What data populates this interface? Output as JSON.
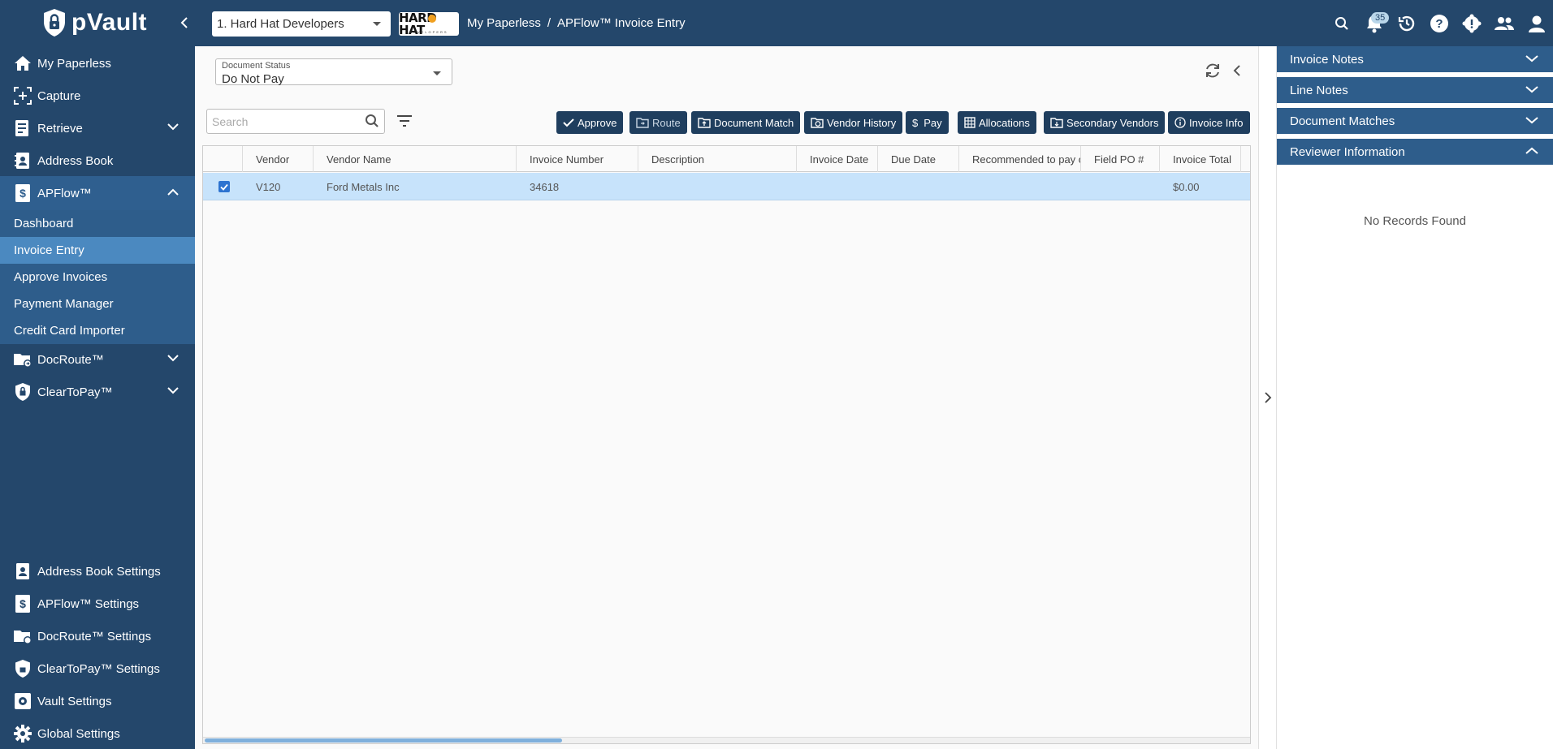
{
  "app": {
    "name": "pVault"
  },
  "header": {
    "company": "1. Hard Hat Developers",
    "company_logo_text": "HARD HAT",
    "company_logo_sub": "DEVELOPERS",
    "breadcrumb": [
      "My Paperless",
      "/",
      "APFlow™ Invoice Entry"
    ],
    "notification_count": "35"
  },
  "sidebar": {
    "items": [
      {
        "label": "My Paperless"
      },
      {
        "label": "Capture"
      },
      {
        "label": "Retrieve"
      },
      {
        "label": "Address Book"
      },
      {
        "label": "APFlow™"
      },
      {
        "label": "DocRoute™"
      },
      {
        "label": "ClearToPay™"
      }
    ],
    "apflow_sub": [
      {
        "label": "Dashboard"
      },
      {
        "label": "Invoice Entry"
      },
      {
        "label": "Approve Invoices"
      },
      {
        "label": "Payment Manager"
      },
      {
        "label": "Credit Card Importer"
      }
    ],
    "settings": [
      {
        "label": "Address Book Settings"
      },
      {
        "label": "APFlow™ Settings"
      },
      {
        "label": "DocRoute™ Settings"
      },
      {
        "label": "ClearToPay™ Settings"
      },
      {
        "label": "Vault Settings"
      },
      {
        "label": "Global Settings"
      }
    ]
  },
  "main": {
    "status_label": "Document Status",
    "status_value": "Do Not Pay",
    "search_placeholder": "Search",
    "actions": [
      {
        "label": "Approve"
      },
      {
        "label": "Route"
      },
      {
        "label": "Document Match"
      },
      {
        "label": "Vendor History"
      },
      {
        "label": "Pay"
      },
      {
        "label": "Allocations"
      },
      {
        "label": "Secondary Vendors"
      },
      {
        "label": "Invoice Info"
      }
    ],
    "columns": [
      "Vendor",
      "Vendor Name",
      "Invoice Number",
      "Description",
      "Invoice Date",
      "Due Date",
      "Recommended to pay on",
      "Field PO #",
      "Invoice Total"
    ],
    "rows": [
      {
        "vendor": "V120",
        "vendor_name": "Ford Metals Inc",
        "invoice_number": "34618",
        "description": "",
        "invoice_date": "",
        "due_date": "",
        "recommended": "",
        "field_po": "",
        "invoice_total": "$0.00",
        "checked": true
      }
    ]
  },
  "right_panel": {
    "sections": [
      {
        "label": "Invoice Notes"
      },
      {
        "label": "Line Notes"
      },
      {
        "label": "Document Matches"
      },
      {
        "label": "Reviewer Information"
      }
    ],
    "empty_text": "No Records Found"
  },
  "colors": {
    "brand": "#24476b",
    "selected_nav": "#4b89c0",
    "row_highlight": "#c7e3fb"
  }
}
